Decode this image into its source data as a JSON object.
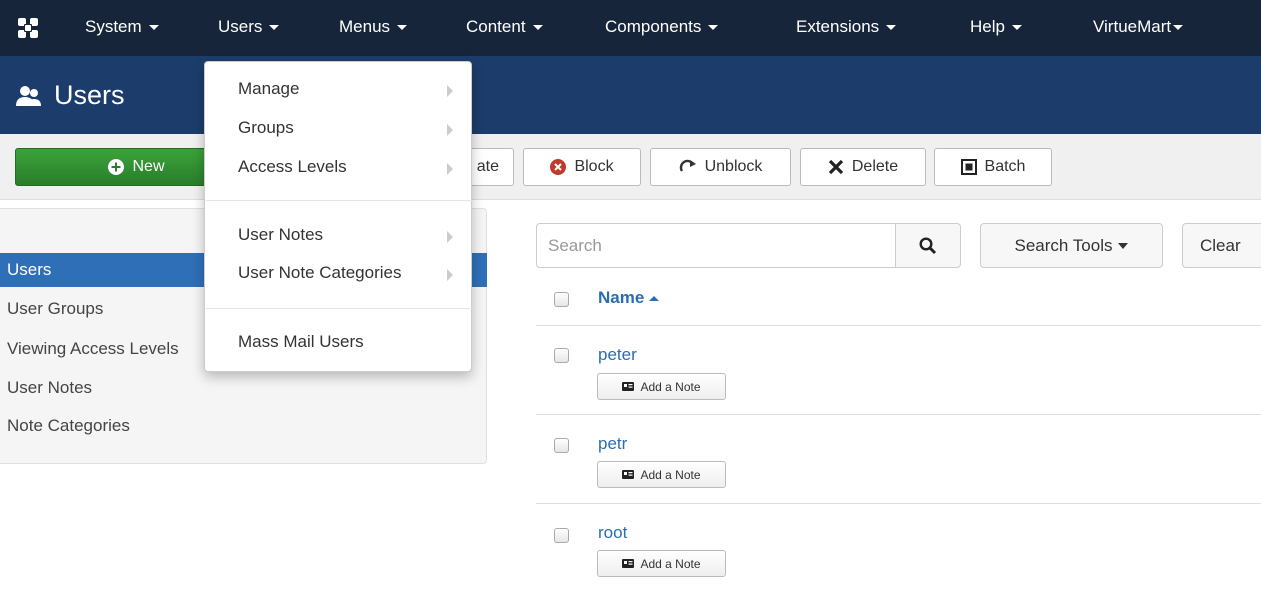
{
  "topnav": {
    "items": [
      {
        "label": "System"
      },
      {
        "label": "Users"
      },
      {
        "label": "Menus"
      },
      {
        "label": "Content"
      },
      {
        "label": "Components"
      },
      {
        "label": "Extensions"
      },
      {
        "label": "Help"
      },
      {
        "label": "VirtueMart"
      }
    ]
  },
  "header": {
    "title": "Users"
  },
  "toolbar": {
    "new_label": "New",
    "activate_partial": "ate",
    "block_label": "Block",
    "unblock_label": "Unblock",
    "delete_label": "Delete",
    "batch_label": "Batch"
  },
  "sidebar": {
    "items": [
      {
        "label": "Users",
        "active": true
      },
      {
        "label": "User Groups"
      },
      {
        "label": "Viewing Access Levels"
      },
      {
        "label": "User Notes"
      },
      {
        "label": "Note Categories"
      }
    ]
  },
  "search": {
    "placeholder": "Search",
    "tools_label": "Search Tools",
    "clear_label": "Clear"
  },
  "table": {
    "name_header": "Name",
    "rows": [
      {
        "name": "peter",
        "note_label": "Add a Note"
      },
      {
        "name": "petr",
        "note_label": "Add a Note"
      },
      {
        "name": "root",
        "note_label": "Add a Note"
      }
    ]
  },
  "users_menu": {
    "items": [
      {
        "label": "Manage",
        "submenu": true
      },
      {
        "label": "Groups",
        "submenu": true
      },
      {
        "label": "Access Levels",
        "submenu": true
      },
      {
        "label": "User Notes",
        "submenu": true
      },
      {
        "label": "User Note Categories",
        "submenu": true
      },
      {
        "label": "Mass Mail Users",
        "submenu": false
      }
    ]
  },
  "colors": {
    "topnav_bg": "#17253b",
    "header_bg": "#1c3d6b",
    "accent_link": "#2a6db5",
    "active_sidebar": "#2e6fb7",
    "new_button": "#2d8a2d",
    "block_icon": "#c0392b"
  },
  "icons": [
    "joomla-logo-icon",
    "users-icon",
    "plus-circle-icon",
    "block-icon",
    "refresh-icon",
    "delete-x-icon",
    "batch-icon",
    "search-icon",
    "note-card-icon"
  ]
}
